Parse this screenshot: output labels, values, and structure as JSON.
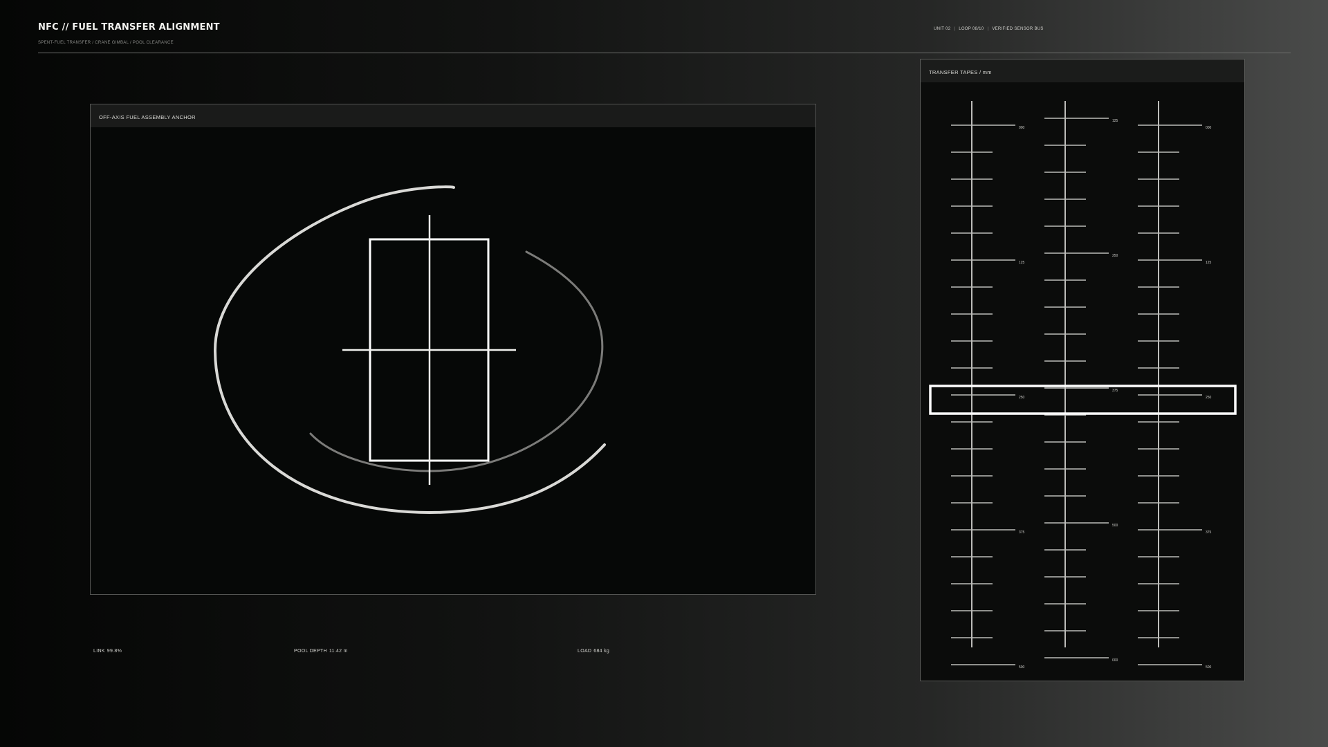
{
  "header": {
    "title": "NFC // FUEL TRANSFER ALIGNMENT",
    "subtitle": "SPENT-FUEL TRANSFER / CRANE GIMBAL / POOL CLEARANCE",
    "status": {
      "unit": "UNIT 02",
      "loop": "LOOP 08/10",
      "bus": "VERIFIED SENSOR BUS"
    }
  },
  "alignment_panel": {
    "title": "OFF-AXIS FUEL ASSEMBLY ANCHOR"
  },
  "tapes_panel": {
    "title": "TRANSFER TAPES / mm",
    "tapes": [
      {
        "name": "tape-1",
        "labels": [
          "000",
          "125",
          "250",
          "375",
          "500"
        ]
      },
      {
        "name": "tape-2",
        "labels": [
          "125",
          "250",
          "375",
          "500",
          "000"
        ]
      },
      {
        "name": "tape-3",
        "labels": [
          "000",
          "125",
          "250",
          "375",
          "500"
        ]
      }
    ],
    "selection_level": 250
  },
  "readouts": {
    "link_label": "LINK",
    "link_value": "99.8%",
    "pool_depth_label": "POOL DEPTH",
    "pool_depth_value": "11.42 m",
    "load_label": "LOAD",
    "load_value": "684 kg"
  },
  "colors": {
    "accent": "#ffffff",
    "stroke_light": "#d9d9d6",
    "stroke_dim": "#7b7b79",
    "panel_bg": "#060807"
  }
}
